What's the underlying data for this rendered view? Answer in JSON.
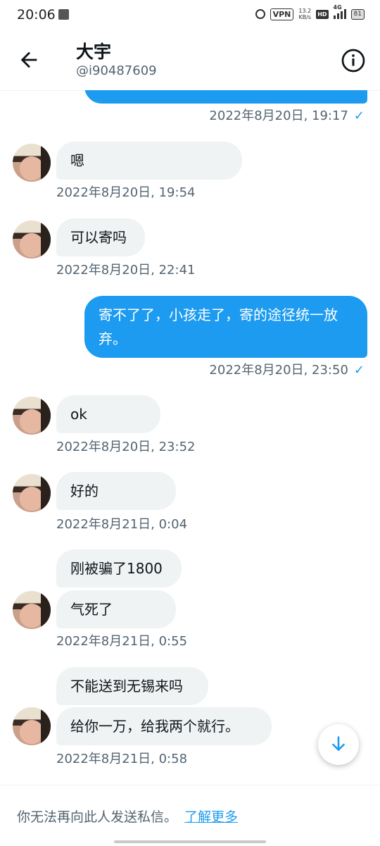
{
  "status_bar": {
    "time": "20:06",
    "vpn": "VPN",
    "speed_value": "13.2",
    "speed_unit": "KB/s",
    "hd": "HD",
    "network": "4G",
    "battery": "81"
  },
  "header": {
    "name": "大宇",
    "handle": "@i90487609"
  },
  "messages": [
    {
      "direction": "out",
      "text": "",
      "timestamp": "2022年8月20日, 19:17",
      "read": true
    },
    {
      "direction": "in",
      "text": "嗯",
      "timestamp": "2022年8月20日, 19:54"
    },
    {
      "direction": "in",
      "text": "可以寄吗",
      "timestamp": "2022年8月20日, 22:41"
    },
    {
      "direction": "out",
      "text": "寄不了了，小孩走了，寄的途径统一放弃。",
      "timestamp": "2022年8月20日, 23:50",
      "read": true
    },
    {
      "direction": "in",
      "text": "ok",
      "timestamp": "2022年8月20日, 23:52"
    },
    {
      "direction": "in",
      "text": "好的",
      "timestamp": "2022年8月21日, 0:04"
    },
    {
      "direction": "in",
      "text": "刚被骗了1800",
      "timestamp": ""
    },
    {
      "direction": "in",
      "text": "气死了",
      "timestamp": "2022年8月21日, 0:55"
    },
    {
      "direction": "in",
      "text": "不能送到无锡来吗",
      "timestamp": ""
    },
    {
      "direction": "in",
      "text": "给你一万，给我两个就行。",
      "timestamp": "2022年8月21日, 0:58"
    }
  ],
  "footer": {
    "notice": "你无法再向此人发送私信。",
    "link": "了解更多"
  },
  "colors": {
    "accent": "#1d9bf0",
    "incoming_bubble": "#eff3f4",
    "secondary_text": "#536471"
  },
  "icons": [
    "back-arrow-icon",
    "info-icon",
    "scroll-down-icon",
    "read-check-icon"
  ]
}
